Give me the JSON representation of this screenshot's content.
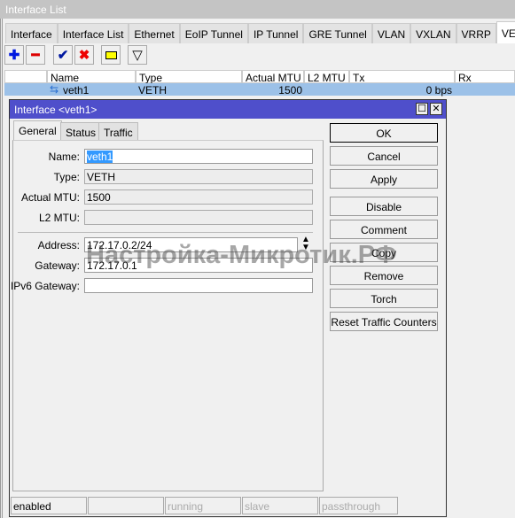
{
  "window": {
    "title": "Interface List"
  },
  "tabs": [
    "Interface",
    "Interface List",
    "Ethernet",
    "EoIP Tunnel",
    "IP Tunnel",
    "GRE Tunnel",
    "VLAN",
    "VXLAN",
    "VRRP",
    "VETH"
  ],
  "active_tab": "VETH",
  "toolbar": {
    "add": "plus-icon",
    "remove": "minus-icon",
    "enable": "check-icon",
    "disable": "x-icon",
    "comment": "note-icon",
    "filter": "filter-icon"
  },
  "table": {
    "columns": [
      "Name",
      "Type",
      "Actual MTU",
      "L2 MTU",
      "Tx",
      "Rx"
    ],
    "rows": [
      {
        "name": "veth1",
        "type": "VETH",
        "actual_mtu": "1500",
        "l2_mtu": "",
        "tx": "0 bps",
        "rx": ""
      }
    ]
  },
  "dialog": {
    "title": "Interface <veth1>",
    "tabs": [
      "General",
      "Status",
      "Traffic"
    ],
    "fields": {
      "name_label": "Name:",
      "name": "veth1",
      "type_label": "Type:",
      "type": "VETH",
      "mtu_label": "Actual MTU:",
      "mtu": "1500",
      "l2_label": "L2 MTU:",
      "l2": "",
      "address_label": "Address:",
      "address": "172.17.0.2/24",
      "gateway_label": "Gateway:",
      "gateway": "172.17.0.1",
      "ipv6_label": "IPv6 Gateway:",
      "ipv6": ""
    },
    "buttons": [
      "OK",
      "Cancel",
      "Apply",
      "Disable",
      "Comment",
      "Copy",
      "Remove",
      "Torch",
      "Reset Traffic Counters"
    ],
    "status": [
      "enabled",
      "",
      "running",
      "slave",
      "passthrough"
    ]
  },
  "watermark": "Настройка-Микротик.РФ",
  "colors": {
    "title_bar": "#4f4fcb",
    "selected_row": "#9cc1e8"
  }
}
